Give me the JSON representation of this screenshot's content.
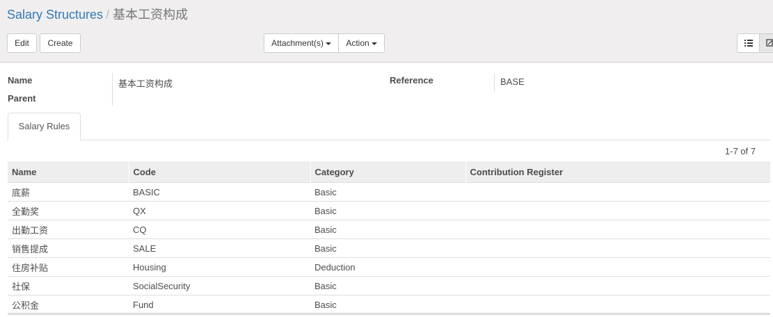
{
  "breadcrumb": {
    "parent": "Salary Structures",
    "separator": "/",
    "current": "基本工资构成"
  },
  "buttons": {
    "edit": "Edit",
    "create": "Create",
    "attachments": "Attachment(s)",
    "action": "Action"
  },
  "view_switcher": {
    "list_icon": "list-icon",
    "form_icon": "form-icon"
  },
  "form": {
    "name_label": "Name",
    "name_value": "基本工资构成",
    "parent_label": "Parent",
    "parent_value": "",
    "reference_label": "Reference",
    "reference_value": "BASE"
  },
  "tabs": [
    {
      "label": "Salary Rules"
    }
  ],
  "pager": "1-7 of 7",
  "table": {
    "columns": [
      "Name",
      "Code",
      "Category",
      "Contribution Register"
    ],
    "rows": [
      [
        "底薪",
        "BASIC",
        "Basic",
        ""
      ],
      [
        "全勤奖",
        "QX",
        "Basic",
        ""
      ],
      [
        "出勤工资",
        "CQ",
        "Basic",
        ""
      ],
      [
        "销售提成",
        "SALE",
        "Basic",
        ""
      ],
      [
        "住房补贴",
        "Housing",
        "Deduction",
        ""
      ],
      [
        "社保",
        "SocialSecurity",
        "Basic",
        ""
      ],
      [
        "公积金",
        "Fund",
        "Basic",
        ""
      ]
    ]
  },
  "colors": {
    "link": "#337ab7",
    "panel_bg": "#f0eeee",
    "header_bg": "#eeeeee"
  }
}
